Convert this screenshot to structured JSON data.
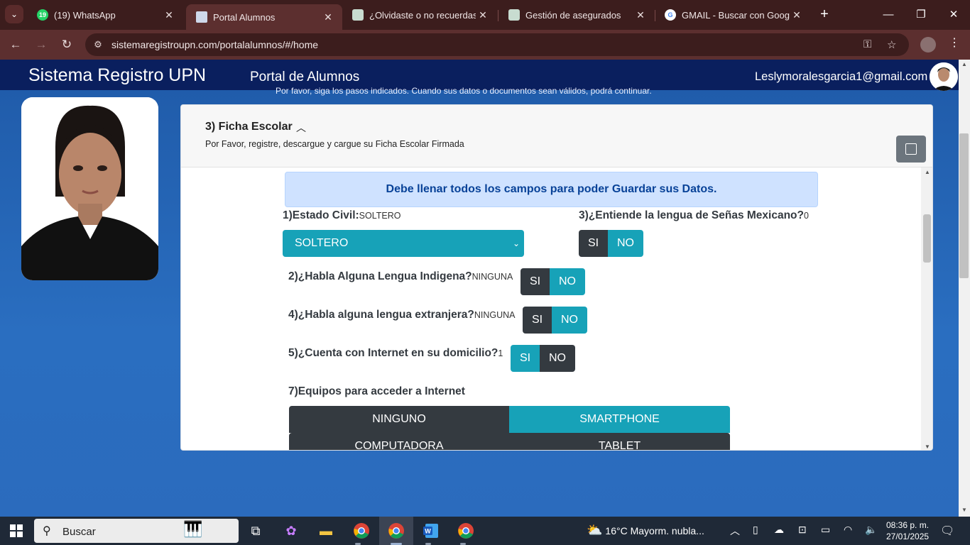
{
  "browser": {
    "tabs": [
      {
        "title": "(19) WhatsApp",
        "badge": "19"
      },
      {
        "title": "Portal Alumnos"
      },
      {
        "title": "¿Olvidaste o no recuerdas tu"
      },
      {
        "title": "Gestión de asegurados"
      },
      {
        "title": "GMAIL - Buscar con Google"
      }
    ],
    "url": "sistemaregistroupn.com/portalalumnos/#/home",
    "new_tab": "+",
    "close": "✕"
  },
  "header": {
    "brand": "Sistema Registro UPN",
    "portal": "Portal de Alumnos",
    "email": "Leslymoralesgarcia1@gmail.com",
    "hint": "Por favor, siga los pasos indicados. Cuando sus datos o documentos sean válidos, podrá continuar."
  },
  "card": {
    "title": "3) Ficha Escolar",
    "subtitle": "Por Favor, registre, descargue y cargue su Ficha Escolar Firmada",
    "alert": "Debe llenar todos los campos para poder Guardar sus Datos."
  },
  "form": {
    "q1": {
      "label": "1)Estado Civil:",
      "value": "SOLTERO",
      "selected": "SOLTERO"
    },
    "q3": {
      "label": "3)¿Entiende la lengua de Señas Mexicano?",
      "value": "0",
      "yes": "SI",
      "no": "NO"
    },
    "q2": {
      "label": "2)¿Habla Alguna Lengua Indigena?",
      "value": "NINGUNA",
      "yes": "SI",
      "no": "NO"
    },
    "q4": {
      "label": "4)¿Habla alguna lengua extranjera?",
      "value": "NINGUNA",
      "yes": "SI",
      "no": "NO"
    },
    "q5": {
      "label": "5)¿Cuenta con Internet en su domicilio?",
      "value": "1",
      "yes": "SI",
      "no": "NO"
    },
    "q7": {
      "label": "7)Equipos para acceder a Internet",
      "options": [
        "NINGUNO",
        "SMARTPHONE",
        "COMPUTADORA",
        "TABLET"
      ]
    }
  },
  "taskbar": {
    "search": "Buscar",
    "weather": "16°C  Mayorm. nubla...",
    "time": "08:36 p. m.",
    "date": "27/01/2025"
  },
  "colors": {
    "teal": "#17a2b8",
    "dark": "#343a40",
    "navbar": "#0a1f5e"
  }
}
